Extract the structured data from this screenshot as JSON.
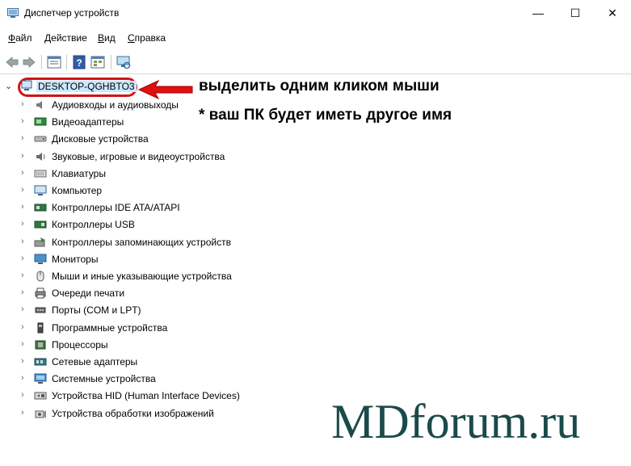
{
  "window": {
    "title": "Диспетчер устройств",
    "minimize": "—",
    "maximize": "☐",
    "close": "✕"
  },
  "menu": [
    {
      "label": "Файл"
    },
    {
      "label": "Действие"
    },
    {
      "label": "Вид"
    },
    {
      "label": "Справка"
    }
  ],
  "toolbar": {
    "icons": [
      "back-arrow-icon",
      "forward-arrow-icon",
      "properties-icon",
      "help-icon",
      "view-icon",
      "scan-hardware-icon"
    ]
  },
  "tree": {
    "root": {
      "chevron": "⌄",
      "label": "DESKTOP-QGHBTO3"
    },
    "items": [
      {
        "label": "Аудиовходы и аудиовыходы",
        "icon": "audio-icon"
      },
      {
        "label": "Видеоадаптеры",
        "icon": "display-adapter-icon"
      },
      {
        "label": "Дисковые устройства",
        "icon": "disk-icon"
      },
      {
        "label": "Звуковые, игровые и видеоустройства",
        "icon": "sound-icon"
      },
      {
        "label": "Клавиатуры",
        "icon": "keyboard-icon"
      },
      {
        "label": "Компьютер",
        "icon": "computer-icon"
      },
      {
        "label": "Контроллеры IDE ATA/ATAPI",
        "icon": "ide-controller-icon"
      },
      {
        "label": "Контроллеры USB",
        "icon": "usb-icon"
      },
      {
        "label": "Контроллеры запоминающих устройств",
        "icon": "storage-controller-icon"
      },
      {
        "label": "Мониторы",
        "icon": "monitor-icon"
      },
      {
        "label": "Мыши и иные указывающие устройства",
        "icon": "mouse-icon"
      },
      {
        "label": "Очереди печати",
        "icon": "printer-icon"
      },
      {
        "label": "Порты (COM и LPT)",
        "icon": "port-icon"
      },
      {
        "label": "Программные устройства",
        "icon": "software-device-icon"
      },
      {
        "label": "Процессоры",
        "icon": "processor-icon"
      },
      {
        "label": "Сетевые адаптеры",
        "icon": "network-adapter-icon"
      },
      {
        "label": "Системные устройства",
        "icon": "system-device-icon"
      },
      {
        "label": "Устройства HID (Human Interface Devices)",
        "icon": "hid-icon"
      },
      {
        "label": "Устройства обработки изображений",
        "icon": "imaging-device-icon"
      }
    ],
    "chevron": "›"
  },
  "annotation": {
    "line1": "выделить одним кликом мыши",
    "line2": "* ваш ПК будет иметь другое имя",
    "arrow_color": "#e01010"
  },
  "watermark": "MDforum.ru",
  "colors": {
    "selection": "#cce8ff",
    "highlight_ring": "#d01414",
    "watermark": "#1a4a4a"
  }
}
